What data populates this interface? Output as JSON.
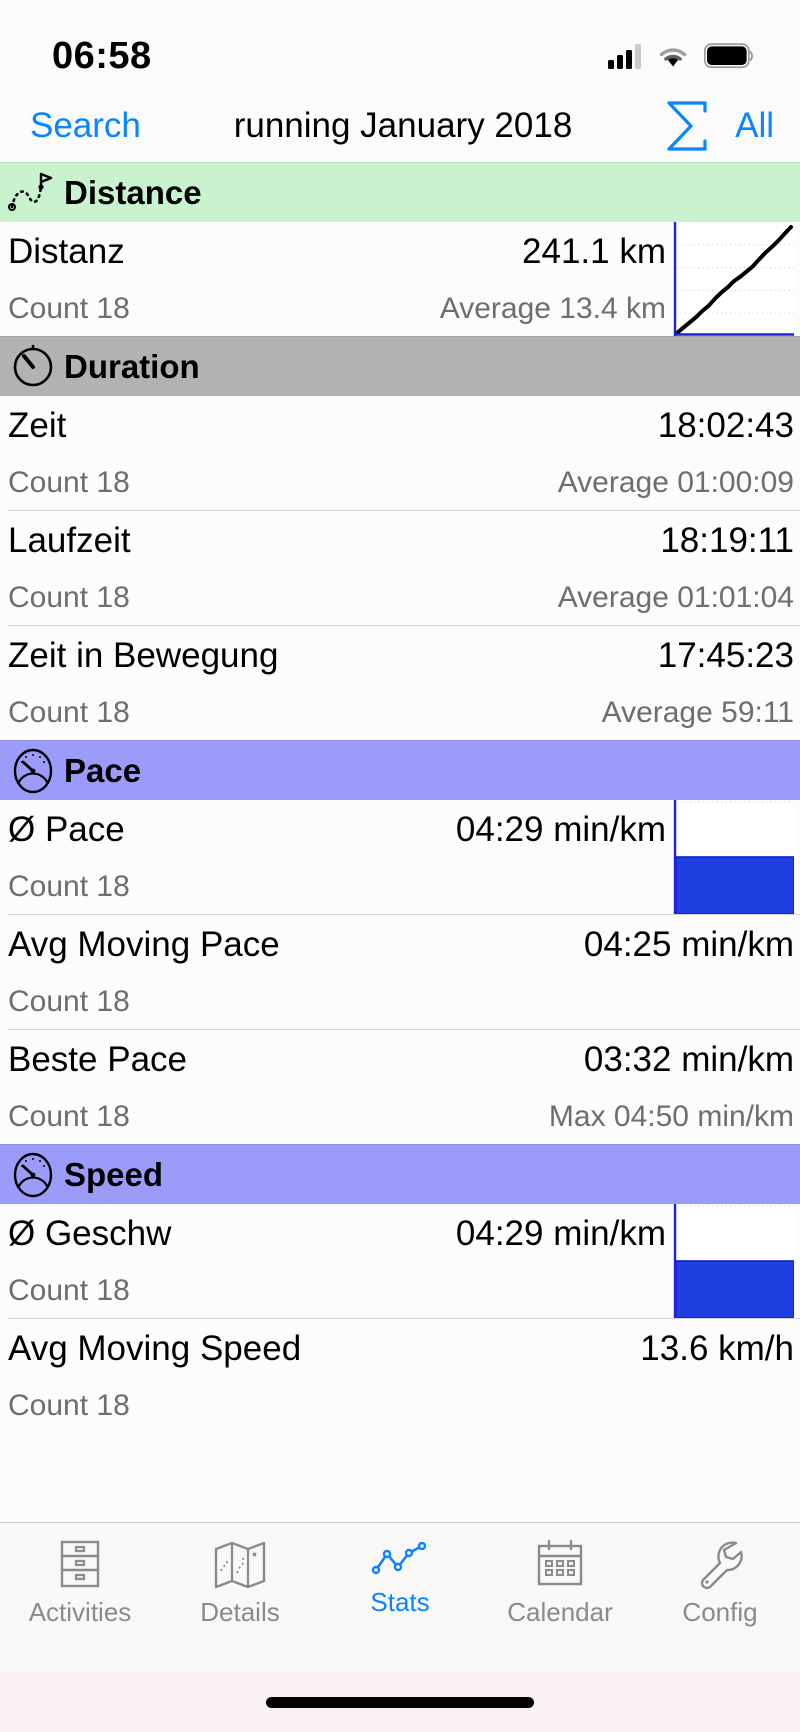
{
  "status_bar": {
    "time": "06:58",
    "cellular_icon": "cellular-signal-icon",
    "wifi_icon": "wifi-icon",
    "battery_icon": "battery-icon"
  },
  "nav_bar": {
    "left_button": "Search",
    "title": "running January 2018",
    "sigma_icon": "sigma-summation-icon",
    "right_button": "All"
  },
  "colors": {
    "accent_blue": "#0A84FF",
    "chart_blue": "#1F3FE0",
    "axis_blue": "#2020E0",
    "distance_header_bg": "#C9F2CE",
    "duration_header_bg": "#B2B2B2",
    "pace_header_bg": "#9B9BFA",
    "speed_header_bg": "#9B9BFA",
    "secondary_text": "#6D6D72"
  },
  "sections": [
    {
      "id": "distance",
      "title": "Distance",
      "icon": "route-path-flag-icon",
      "style": "sec-green",
      "rows": [
        {
          "label": "Distanz",
          "value": "241.1 km",
          "count_label": "Count 18",
          "sub_value": "Average 13.4 km",
          "chart": "cumulative-line"
        }
      ]
    },
    {
      "id": "duration",
      "title": "Duration",
      "icon": "stopwatch-icon",
      "style": "sec-gray",
      "rows": [
        {
          "label": "Zeit",
          "value": "18:02:43",
          "count_label": "Count 18",
          "sub_value": "Average 01:00:09",
          "chart": null
        },
        {
          "label": "Laufzeit",
          "value": "18:19:11",
          "count_label": "Count 18",
          "sub_value": "Average 01:01:04",
          "chart": null
        },
        {
          "label": "Zeit in Bewegung",
          "value": "17:45:23",
          "count_label": "Count 18",
          "sub_value": "Average 59:11",
          "chart": null
        }
      ]
    },
    {
      "id": "pace",
      "title": "Pace",
      "icon": "speedometer-icon",
      "style": "sec-purple",
      "rows": [
        {
          "label": "Ø Pace",
          "value": "04:29 min/km",
          "count_label": "Count 18",
          "sub_value": "",
          "chart": "half-bar"
        },
        {
          "label": "Avg Moving Pace",
          "value": "04:25 min/km",
          "count_label": "Count 18",
          "sub_value": "",
          "chart": null
        },
        {
          "label": "Beste Pace",
          "value": "03:32 min/km",
          "count_label": "Count 18",
          "sub_value": "Max 04:50 min/km",
          "chart": null
        }
      ]
    },
    {
      "id": "speed",
      "title": "Speed",
      "icon": "speedometer-icon",
      "style": "sec-purple",
      "rows": [
        {
          "label": "Ø Geschw",
          "value": "04:29 min/km",
          "count_label": "Count 18",
          "sub_value": "",
          "chart": "half-bar"
        },
        {
          "label": "Avg Moving Speed",
          "value": "13.6 km/h",
          "count_label": "Count 18",
          "sub_value": "",
          "chart": null
        }
      ]
    }
  ],
  "chart_data": [
    {
      "type": "line",
      "id": "distance-sparkline",
      "title": "Distanz",
      "xlabel": "",
      "ylabel": "km",
      "grid": true,
      "legend": false,
      "x": [
        0,
        1,
        2,
        3,
        4,
        5,
        6,
        7,
        8,
        9,
        10,
        11,
        12,
        13,
        14,
        15,
        16,
        17,
        18
      ],
      "values": [
        0,
        12,
        24,
        36,
        50,
        62,
        78,
        92,
        104,
        118,
        128,
        140,
        152,
        168,
        183,
        196,
        210,
        226,
        241.1
      ],
      "ylim": [
        0,
        241.1
      ],
      "total": "241.1 km",
      "count": 18,
      "average": "13.4 km"
    },
    {
      "type": "bar",
      "id": "pace-bar",
      "title": "Ø Pace",
      "categories": [
        "Ø Pace"
      ],
      "values": [
        0.5
      ],
      "ylim": [
        0,
        1
      ],
      "grid": true,
      "legend": false,
      "value_label": "04:29 min/km",
      "count": 18
    },
    {
      "type": "bar",
      "id": "speed-bar",
      "title": "Ø Geschw",
      "categories": [
        "Ø Geschw"
      ],
      "values": [
        0.5
      ],
      "ylim": [
        0,
        1
      ],
      "grid": true,
      "legend": false,
      "value_label": "04:29 min/km",
      "count": 18
    }
  ],
  "tab_bar": {
    "tabs": [
      {
        "label": "Activities",
        "icon": "file-cabinet-icon",
        "active": false
      },
      {
        "label": "Details",
        "icon": "folded-map-icon",
        "active": false
      },
      {
        "label": "Stats",
        "icon": "line-chart-icon",
        "active": true
      },
      {
        "label": "Calendar",
        "icon": "calendar-icon",
        "active": false
      },
      {
        "label": "Config",
        "icon": "wrench-icon",
        "active": false
      }
    ]
  }
}
